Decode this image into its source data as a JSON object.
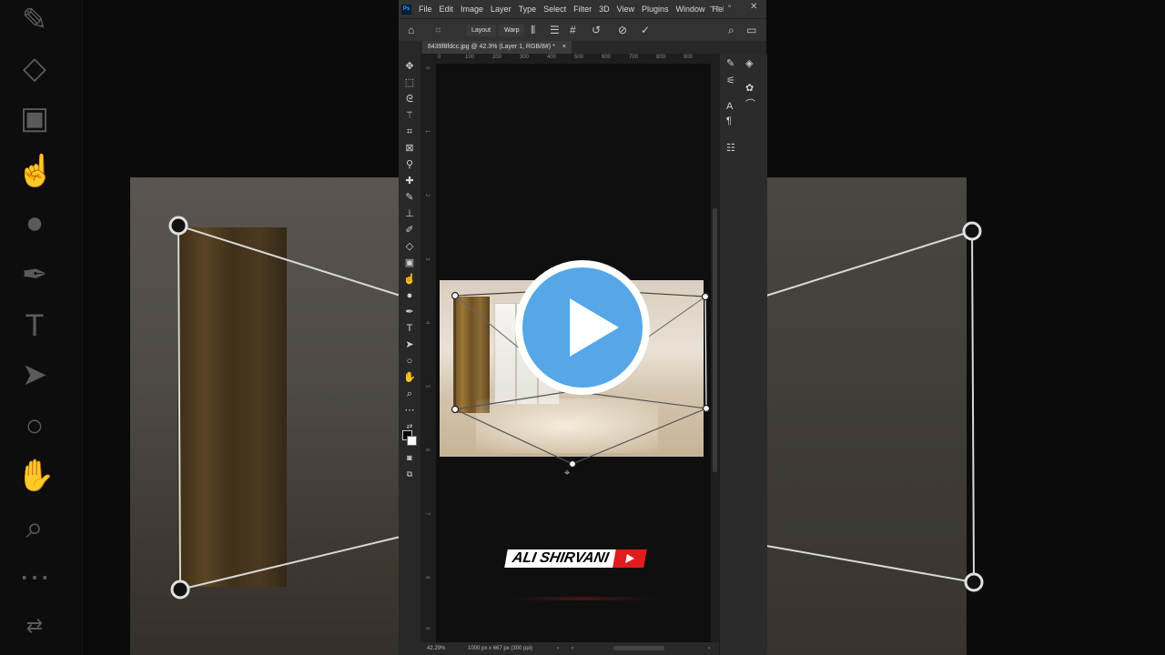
{
  "app": {
    "logo_text": "Ps"
  },
  "menu": {
    "items": [
      "File",
      "Edit",
      "Image",
      "Layer",
      "Type",
      "Select",
      "Filter",
      "3D",
      "View",
      "Plugins",
      "Window",
      "Help"
    ]
  },
  "options_bar": {
    "layout_label": "Layout",
    "warp_label": "Warp"
  },
  "document": {
    "tab_title": "8439f8fdcc.jpg @ 42.3% (Layer 1, RGB/8#) *",
    "tab_close": "×"
  },
  "ruler": {
    "top_ticks": [
      "0",
      "100",
      "200",
      "300",
      "400",
      "500",
      "600",
      "700",
      "800",
      "900"
    ],
    "left_ticks": [
      "0",
      "1",
      "2",
      "3",
      "4",
      "5",
      "6",
      "7",
      "8",
      "9"
    ]
  },
  "status": {
    "zoom": "42.29%",
    "doc_info": "1000 px x 667 px (300 ppi)"
  },
  "watermark": {
    "brand": "ALI SHIRVANI"
  },
  "colors": {
    "play_blue": "#55a7e8",
    "brand_red": "#e21b1b"
  },
  "icons": {
    "tools": [
      "move-icon",
      "marquee-icon",
      "lasso-icon",
      "magic-wand-icon",
      "crop-icon",
      "frame-icon",
      "eyedropper-icon",
      "healing-icon",
      "brush-icon",
      "stamp-icon",
      "history-brush-icon",
      "eraser-icon",
      "gradient-icon",
      "blur-icon",
      "dodge-icon",
      "pen-icon",
      "type-icon",
      "path-select-icon",
      "ellipse-icon",
      "hand-icon",
      "zoom-icon",
      "more-tools-icon"
    ]
  }
}
